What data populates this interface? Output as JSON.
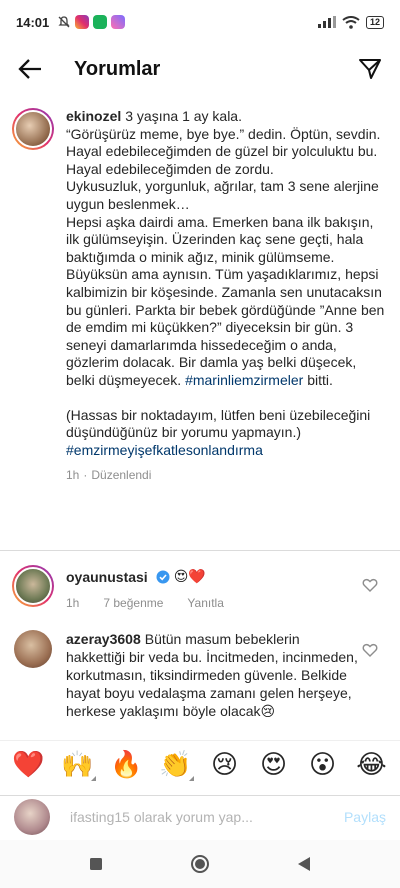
{
  "status": {
    "time": "14:01",
    "battery": "12"
  },
  "header": {
    "title": "Yorumlar"
  },
  "caption": {
    "username": "ekinozel",
    "text": "3 yaşına 1 ay kala.\n“Görüşürüz meme, bye bye.” dedin. Öptün, sevdin.\nHayal edebileceğimden de güzel bir yolculuktu bu.\nHayal edebileceğimden de zordu.\nUykusuzluk, yorgunluk, ağrılar, tam 3 sene alerjine uygun beslenmek…\nHepsi aşka dairdi ama. Emerken bana ilk bakışın, ilk gülümseyişin. Üzerinden kaç sene geçti, hala baktığımda o minik ağız, minik gülümseme. Büyüksün ama aynısın. Tüm yaşadıklarımız, hepsi kalbimizin bir köşesinde. Zamanla sen unutacaksın bu günleri. Parkta bir bebek gördüğünde ”Anne ben de emdim mi küçükken?” diyeceksin bir gün. 3 seneyi damarlarımda hissedeceğim o anda, gözlerim dolacak. Bir damla yaş belki düşecek, belki düşmeyecek.",
    "hashtag1": "#marinliemzirmeler",
    "after_hashtag1": "bitti.",
    "note": "(Hassas bir noktadayım, lütfen beni üzebileceğini düşündüğünüz bir yorumu yapmayın.)",
    "hashtag2": "#emzirmeyişefkatlesonlandırma",
    "time": "1h",
    "separator": "·",
    "edited": "Düzenlendi"
  },
  "comments": [
    {
      "username": "oyaunustasi",
      "text": "😍❤️",
      "time": "1h",
      "likes": "7 beğenme",
      "reply": "Yanıtla"
    },
    {
      "username": "azeray3608",
      "text": "Bütün masum bebeklerin hakkettiği bir veda bu. İncitmeden, incinmeden, korkutmasın, tiksindirmeden güvenle. Belkide hayat boyu vedalaşma zamanı gelen herşeye, herkese yaklaşımı böyle olacak😢"
    }
  ],
  "emoji_bar": [
    "❤️",
    "🙌",
    "🔥",
    "👏",
    "😢",
    "😍",
    "😮",
    "😂"
  ],
  "input": {
    "placeholder": "ifasting15 olarak yorum yap...",
    "post_label": "Paylaş"
  }
}
